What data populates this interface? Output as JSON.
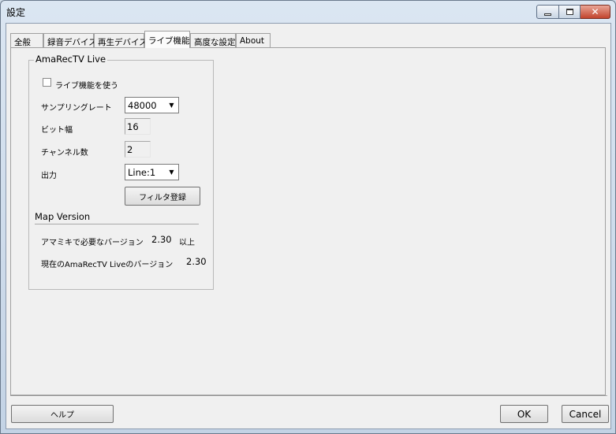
{
  "window": {
    "title": "設定",
    "controls": {
      "minimize_icon": "minimize-icon",
      "maximize_icon": "maximize-icon",
      "close_icon": "close-icon",
      "close_glyph": "✕"
    }
  },
  "tabs": [
    {
      "label": "全般"
    },
    {
      "label": "録音デバイス"
    },
    {
      "label": "再生デバイス"
    },
    {
      "label": "ライブ機能",
      "active": true
    },
    {
      "label": "高度な設定"
    },
    {
      "label": "About"
    }
  ],
  "live": {
    "group_title": "AmaRecTV Live",
    "use_live_label": "ライブ機能を使う",
    "use_live_checked": false,
    "sampling_rate_label": "サンプリングレート",
    "sampling_rate_value": "48000",
    "bit_width_label": "ビット幅",
    "bit_width_value": "16",
    "channels_label": "チャンネル数",
    "channels_value": "2",
    "output_label": "出力",
    "output_value": "Line:1",
    "filter_button": "フィルタ登録",
    "dropdown_arrow": "▼"
  },
  "map_version": {
    "title": "Map Version",
    "required_label": "アマミキで必要なバージョン",
    "required_value": "2.30",
    "required_suffix": "以上",
    "current_label": "現在のAmaRecTV Liveのバージョン",
    "current_value": "2.30"
  },
  "footer": {
    "help_button": "ヘルプ",
    "ok_button": "OK",
    "cancel_button": "Cancel"
  },
  "colors": {
    "titlebar": "#dbe6f2",
    "close_button": "#c2442d",
    "panel_background": "#f0f0f0"
  }
}
